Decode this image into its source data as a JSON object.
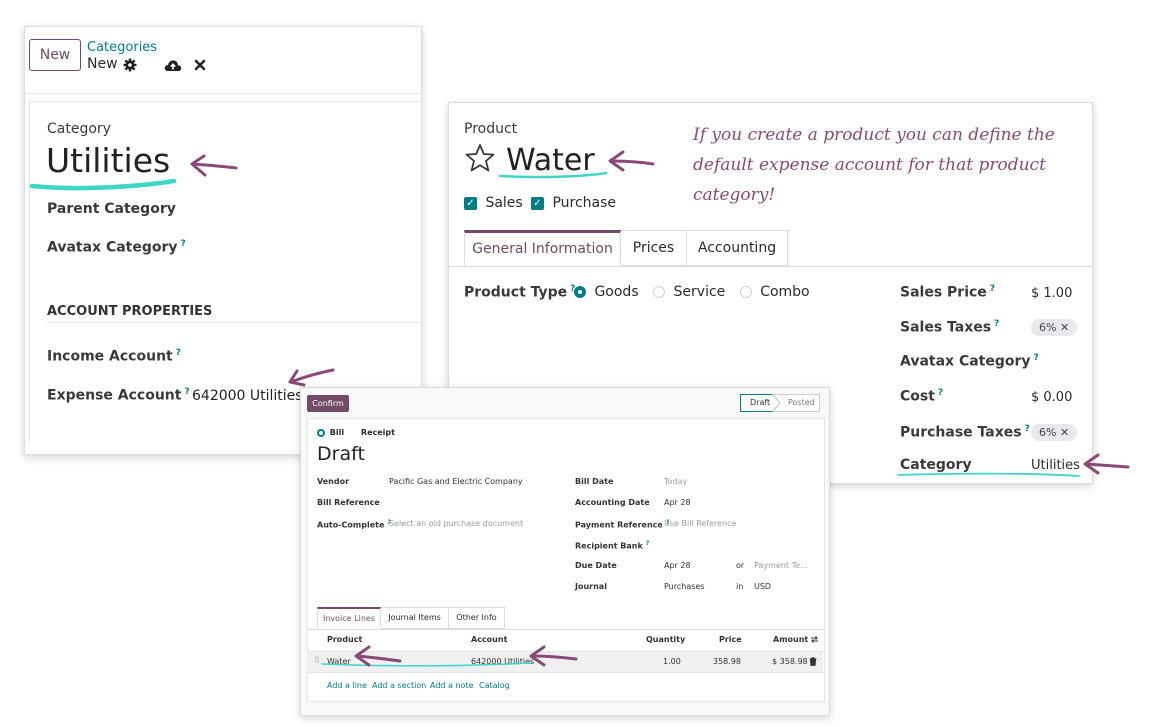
{
  "category_form": {
    "new_button": "New",
    "breadcrumb_parent": "Categories",
    "breadcrumb_current": "New",
    "section_label": "Category",
    "name": "Utilities",
    "parent_category_label": "Parent Category",
    "avatax_category_label": "Avatax Category",
    "account_properties_heading": "ACCOUNT PROPERTIES",
    "income_account_label": "Income Account",
    "expense_account_label": "Expense Account",
    "expense_account_value": "642000 Utilities",
    "help_mark": "?"
  },
  "product_form": {
    "section_label": "Product",
    "name": "Water",
    "sales_label": "Sales",
    "purchase_label": "Purchase",
    "tabs": [
      "General Information",
      "Prices",
      "Accounting"
    ],
    "product_type_label": "Product Type",
    "product_type_options": [
      "Goods",
      "Service",
      "Combo"
    ],
    "sales_price_label": "Sales Price",
    "sales_price_value": "$ 1.00",
    "sales_taxes_label": "Sales Taxes",
    "sales_taxes_value": "6%",
    "avatax_category_label": "Avatax Category",
    "cost_label": "Cost",
    "cost_value": "$ 0.00",
    "purchase_taxes_label": "Purchase Taxes",
    "purchase_taxes_value": "6%",
    "category_label": "Category",
    "category_value": "Utilities",
    "help_mark": "?",
    "remove_mark": "✕"
  },
  "annotation": {
    "line1": "If you create a product you can define the",
    "line2": "default expense account for that product",
    "line3": "category!"
  },
  "bill_form": {
    "confirm_button": "Confirm",
    "status_draft": "Draft",
    "status_posted": "Posted",
    "type_bill": "Bill",
    "type_receipt": "Receipt",
    "title": "Draft",
    "vendor_label": "Vendor",
    "vendor_value": "Pacific Gas and Electric Company",
    "bill_reference_label": "Bill Reference",
    "auto_complete_label": "Auto-Complete",
    "auto_complete_placeholder": "Select an old purchase document",
    "bill_date_label": "Bill Date",
    "bill_date_value": "Today",
    "accounting_date_label": "Accounting Date",
    "accounting_date_value": "Apr 28",
    "payment_reference_label": "Payment Reference",
    "payment_reference_placeholder": "Use Bill Reference",
    "recipient_bank_label": "Recipient Bank",
    "due_date_label": "Due Date",
    "due_date_value": "Apr 28",
    "due_or": "or",
    "payment_terms_placeholder": "Payment Te...",
    "journal_label": "Journal",
    "journal_value": "Purchases",
    "journal_in": "in",
    "currency": "USD",
    "tabs": [
      "Invoice Lines",
      "Journal Items",
      "Other Info"
    ],
    "columns": [
      "Product",
      "Account",
      "Quantity",
      "Price",
      "Amount"
    ],
    "line": {
      "product": "Water",
      "account": "642000 Utilities",
      "quantity": "1.00",
      "price": "358.98",
      "amount": "$ 358.98"
    },
    "add_links": [
      "Add a line",
      "Add a section",
      "Add a note",
      "Catalog"
    ],
    "help_mark": "?"
  },
  "colors": {
    "brand": "#714b67",
    "accent": "#017e84",
    "highlight": "#3fd6c8",
    "arrow": "#8a4a78"
  }
}
